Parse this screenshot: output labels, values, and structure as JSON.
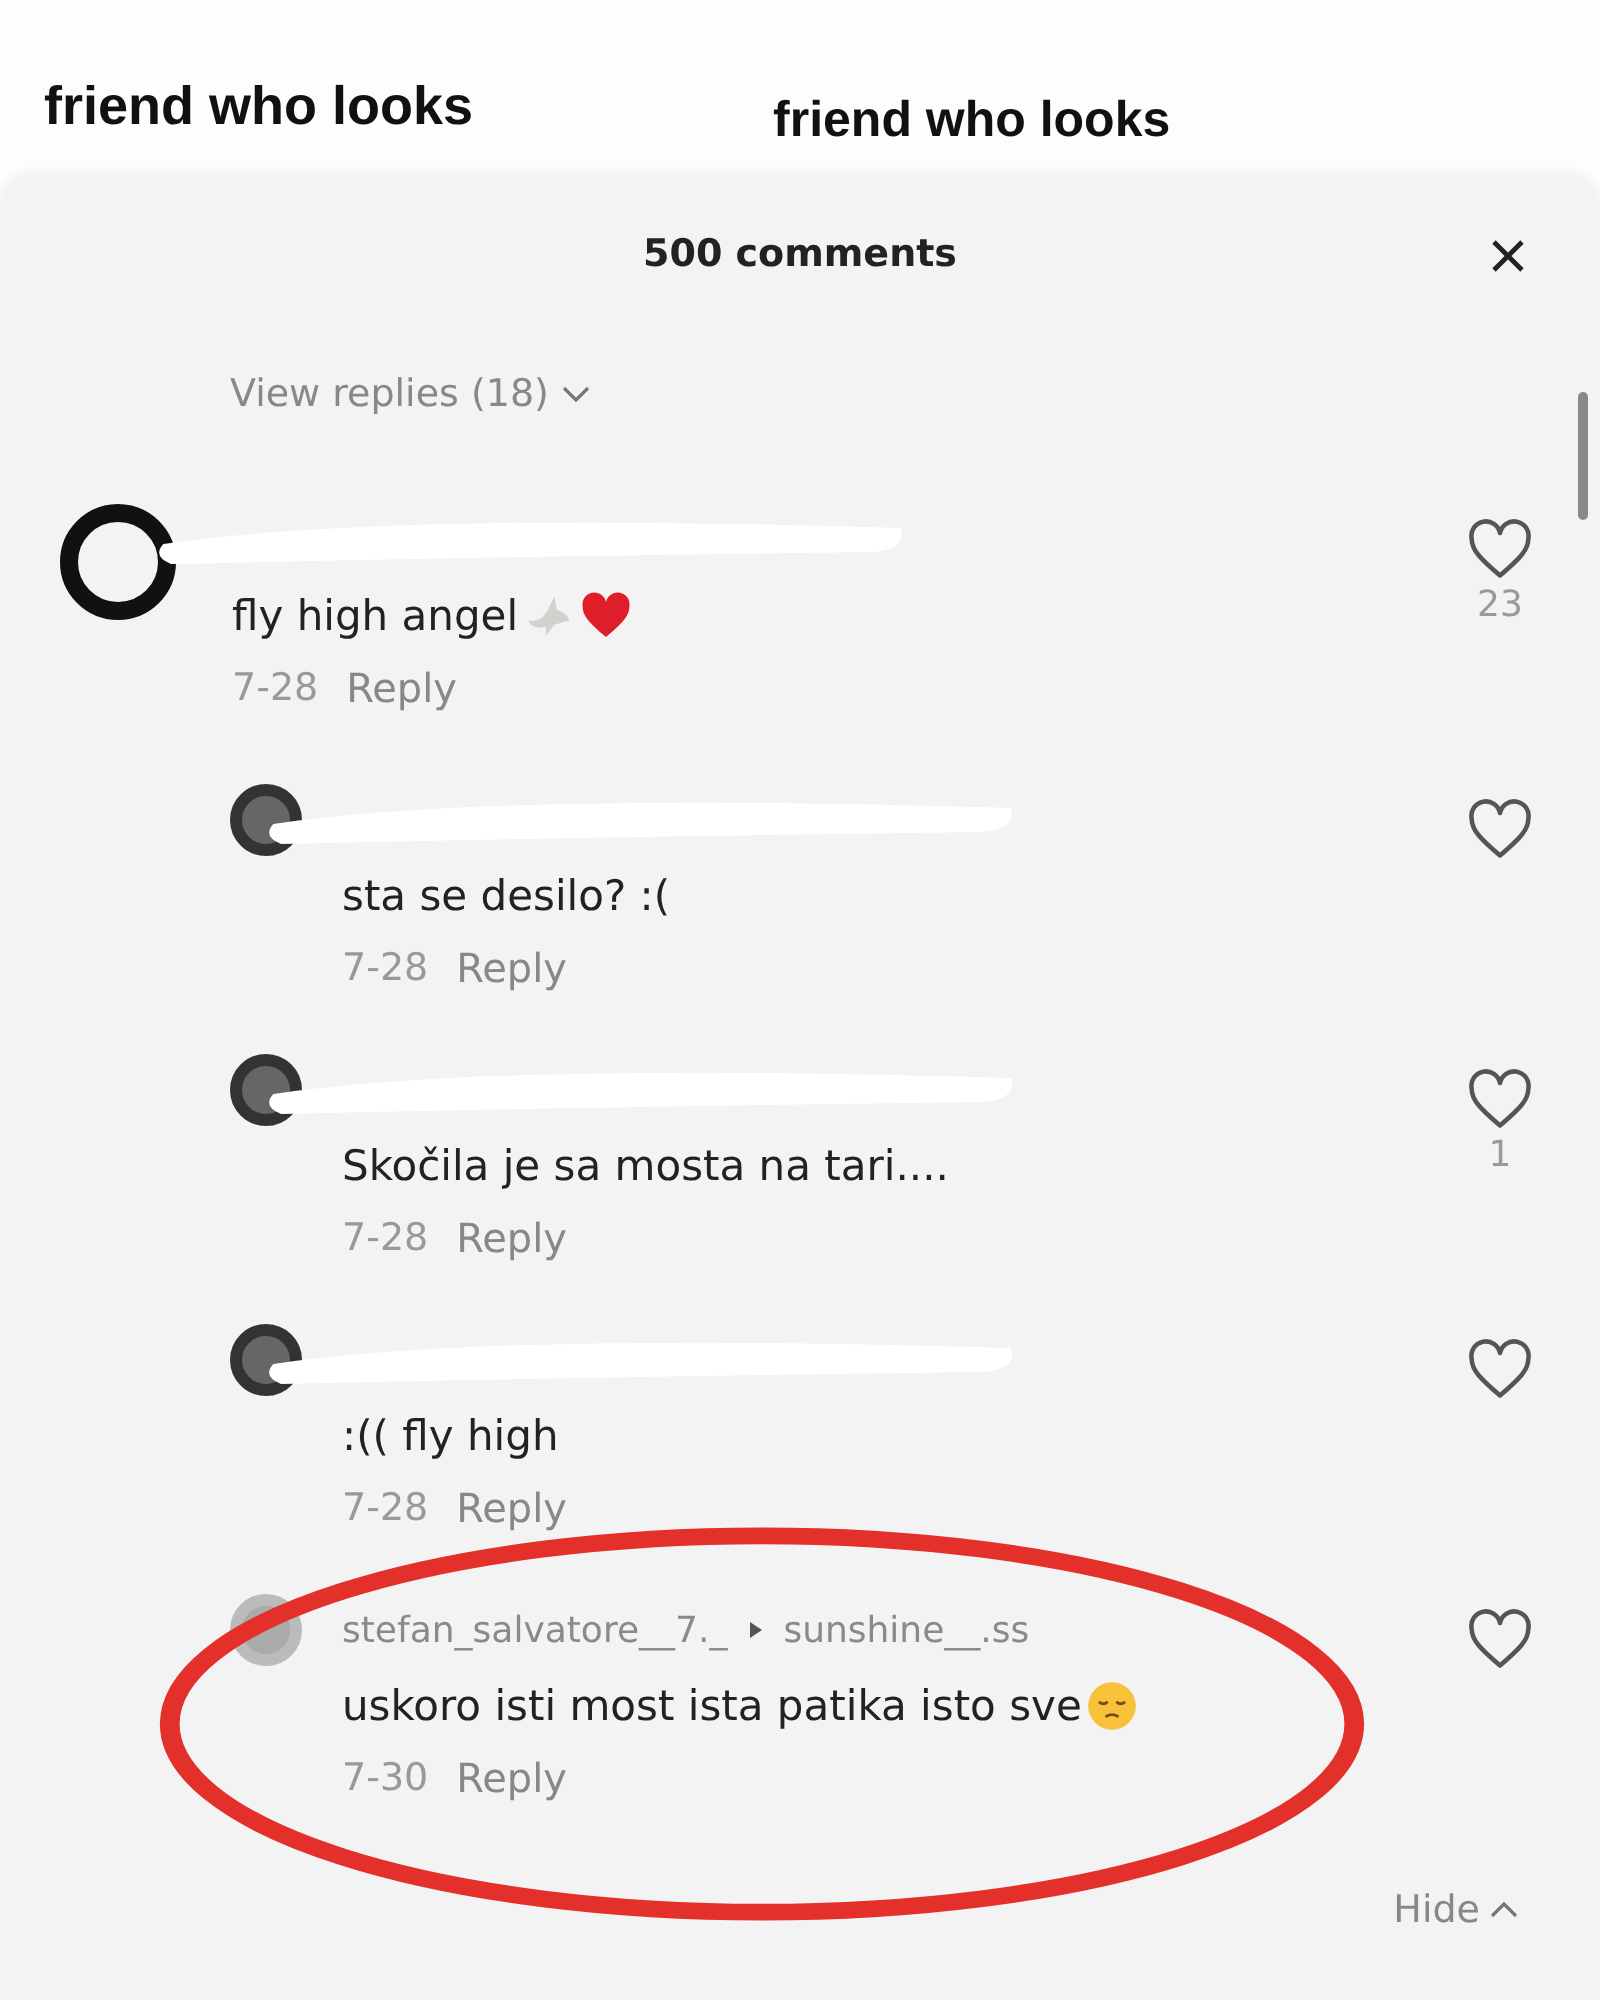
{
  "background_video": {
    "captions": [
      "friend who looks",
      "friend who looks"
    ]
  },
  "comments_sheet": {
    "title": "500 comments",
    "view_replies": "View replies (18)",
    "comments": [
      {
        "name_redacted": true,
        "text": "fly high angel",
        "emoji": {
          "kind": "dove-heart"
        },
        "date": "7-28",
        "reply": "Reply",
        "liked": false,
        "likes": "23",
        "circled": false,
        "children": [
          {
            "name_redacted": true,
            "text": "sta se desilo? :(",
            "date": "7-28",
            "reply": "Reply",
            "liked": false,
            "circled": false
          },
          {
            "name_redacted": true,
            "text": "Skočila je sa mosta na tari....",
            "date": "7-28",
            "reply": "Reply",
            "liked": false,
            "likes": "1",
            "circled": false
          },
          {
            "name_redacted": true,
            "text": ":(( fly high",
            "date": "7-28",
            "reply": "Reply",
            "liked": false,
            "circled": false
          },
          {
            "name_redacted": false,
            "author": "stefan_salvatore__7._",
            "replying_to": "sunshine__.ss",
            "text": "uskoro isti most ista patika isto sve",
            "emoji": {
              "kind": "pensive"
            },
            "date": "7-30",
            "reply": "Reply",
            "liked": false,
            "circled": true
          }
        ]
      }
    ],
    "hide": "Hide"
  }
}
